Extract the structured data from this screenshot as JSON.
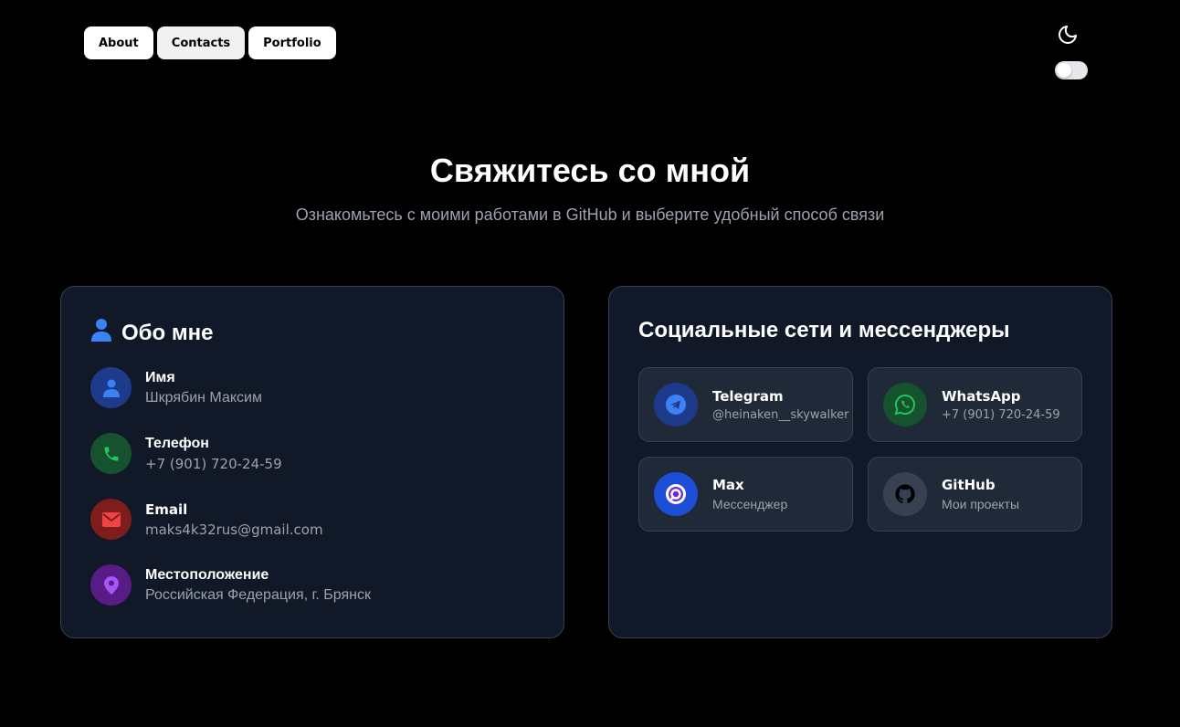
{
  "nav": {
    "items": [
      {
        "label": "About"
      },
      {
        "label": "Contacts"
      },
      {
        "label": "Portfolio"
      }
    ]
  },
  "theme": {
    "icon": "moon-icon",
    "toggle_state": "off"
  },
  "header": {
    "title": "Свяжитесь со мной",
    "subtitle": "Ознакомьтесь с моими работами в GitHub и выберите удобный способ связи"
  },
  "about": {
    "title": "Обо мне",
    "icon": "user-icon",
    "items": [
      {
        "label": "Имя",
        "value": "Шкрябин Максим",
        "icon": "user-icon",
        "color": "#3b82f6"
      },
      {
        "label": "Телефон",
        "value": "+7 (901) 720-24-59",
        "icon": "phone-icon",
        "color": "#22c55e"
      },
      {
        "label": "Email",
        "value": "maks4k32rus@gmail.com",
        "icon": "mail-icon",
        "color": "#ef4444"
      },
      {
        "label": "Местоположение",
        "value": "Российская Федерация, г. Брянск",
        "icon": "location-pin-icon",
        "color": "#a855f7"
      }
    ]
  },
  "social": {
    "title": "Социальные сети и мессенджеры",
    "items": [
      {
        "name": "Telegram",
        "sub": "@heinaken__skywalker",
        "icon": "telegram-icon",
        "color": "#3b82f6"
      },
      {
        "name": "WhatsApp",
        "sub": "+7 (901) 720-24-59",
        "icon": "whatsapp-icon",
        "color": "#22c55e"
      },
      {
        "name": "Max",
        "sub": "Мессенджер",
        "icon": "max-icon",
        "color": "#4f46e5"
      },
      {
        "name": "GitHub",
        "sub": "Мои проекты",
        "icon": "github-icon",
        "color": "#111827"
      }
    ]
  },
  "colors": {
    "background": "#000000",
    "card": "#111827",
    "card_border": "#374151",
    "muted_text": "#9ca3af",
    "accent": "#3b82f6"
  }
}
